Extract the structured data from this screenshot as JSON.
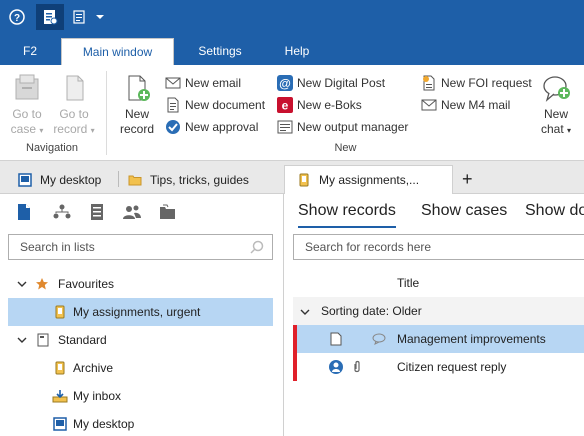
{
  "quick_access": {
    "help_icon": "help-icon",
    "records_icon": "records-icon",
    "list_icon": "list-icon",
    "dropdown_icon": "chevron-down-icon"
  },
  "ribbon_tabs": {
    "f2": "F2",
    "main_window": "Main window",
    "settings": "Settings",
    "help": "Help"
  },
  "ribbon": {
    "goto_case_1": "Go to",
    "goto_case_2": "case",
    "goto_record_1": "Go to",
    "goto_record_2": "record",
    "navigation_label": "Navigation",
    "new_record_1": "New",
    "new_record_2": "record",
    "new_email": "New email",
    "new_document": "New document",
    "new_approval": "New approval",
    "new_digital_post": "New Digital Post",
    "new_eboks": "New e-Boks",
    "new_output_manager": "New output manager",
    "new_foi_request": "New FOI request",
    "new_m4_mail": "New M4 mail",
    "new_chat_1": "New",
    "new_chat_2": "chat",
    "new_group_label": "New"
  },
  "doc_tabs": {
    "my_desktop": "My desktop",
    "tips": "Tips, tricks, guides",
    "my_assignments": "My assignments,...",
    "add": "+"
  },
  "left_pane": {
    "search_placeholder": "Search in lists",
    "favourites": "Favourites",
    "my_assignments_urgent": "My assignments, urgent",
    "standard": "Standard",
    "archive": "Archive",
    "my_inbox": "My inbox",
    "my_desktop": "My desktop"
  },
  "right_pane": {
    "tab_show_records": "Show records",
    "tab_show_cases": "Show cases",
    "tab_show_documents": "Show do",
    "search_placeholder": "Search for records here",
    "column_title": "Title",
    "group_label": "Sorting date: Older",
    "rows": [
      {
        "title": "Management improvements"
      },
      {
        "title": "Citizen request reply"
      }
    ]
  },
  "colors": {
    "brand_blue": "#1e5fa8",
    "selection": "#b7d6f3",
    "flag_red": "#e0202a",
    "accent_green": "#5cb85c"
  }
}
